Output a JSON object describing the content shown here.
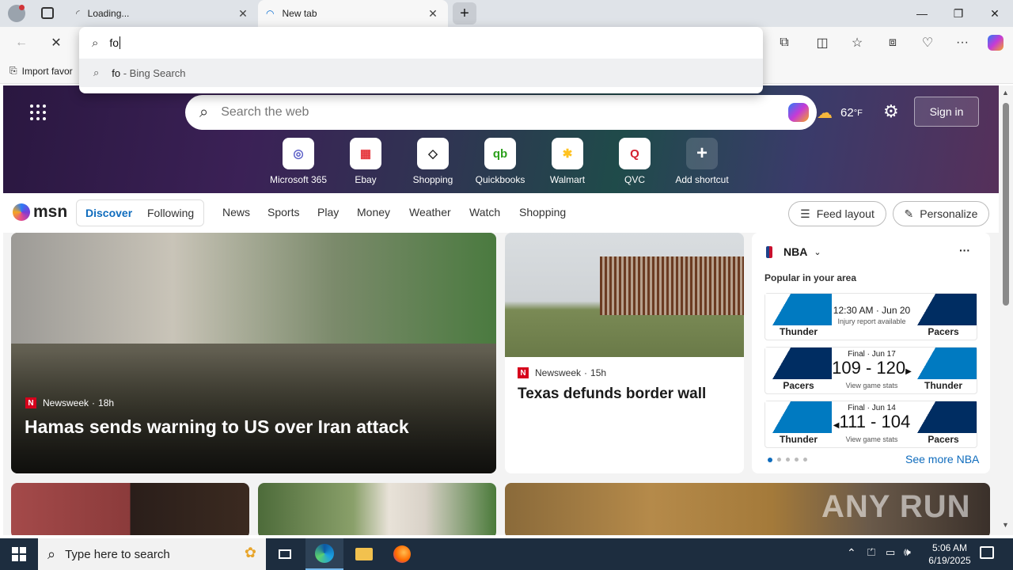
{
  "browser": {
    "tabs": [
      {
        "title": "Loading...",
        "close": "✕"
      },
      {
        "title": "New tab",
        "close": "✕"
      }
    ],
    "new_tab_symbol": "+",
    "window_controls": {
      "minimize": "—",
      "restore": "❐",
      "close": "✕"
    },
    "address_value": "fo",
    "suggestion": {
      "query": "fo",
      "suffix": " - Bing Search"
    },
    "favorites_import_label": "Import favor"
  },
  "msn": {
    "search_placeholder": "Search the web",
    "weather_temp": "62",
    "weather_unit": "°F",
    "sign_in": "Sign in",
    "shortcuts": [
      {
        "label": "Microsoft 365",
        "icon": "microsoft-365-icon",
        "glyph": "◎",
        "color": "#5b5fc7"
      },
      {
        "label": "Ebay",
        "icon": "ebay-icon",
        "glyph": "▦",
        "color": "#e53238"
      },
      {
        "label": "Shopping",
        "icon": "shopping-tag-icon",
        "glyph": "◇",
        "color": "#222222"
      },
      {
        "label": "Quickbooks",
        "icon": "quickbooks-icon",
        "glyph": "qb",
        "color": "#2ca01c"
      },
      {
        "label": "Walmart",
        "icon": "walmart-icon",
        "glyph": "✱",
        "color": "#ffc220"
      },
      {
        "label": "QVC",
        "icon": "qvc-icon",
        "glyph": "Q",
        "color": "#d4212f"
      },
      {
        "label": "Add shortcut",
        "icon": "add-icon",
        "glyph": "+",
        "color": "#ffffff"
      }
    ],
    "logo_text": "msn",
    "feed_tabs": {
      "active": "Discover",
      "other": "Following"
    },
    "nav_links": [
      "News",
      "Sports",
      "Play",
      "Money",
      "Weather",
      "Watch",
      "Shopping"
    ],
    "feed_layout": "Feed layout",
    "personalize": "Personalize"
  },
  "cards": {
    "main": {
      "source": "Newsweek",
      "age": "18h",
      "headline": "Hamas sends warning to US over Iran attack"
    },
    "border": {
      "source": "Newsweek",
      "age": "15h",
      "headline": "Texas defunds border wall"
    }
  },
  "nba": {
    "title": "NBA",
    "subtitle": "Popular in your area",
    "games": [
      {
        "left": "Thunder",
        "right": "Pacers",
        "line1": "12:30 AM · Jun 20",
        "line2": "Injury report available",
        "score": "",
        "colors": [
          "#007ac1",
          "#002d62"
        ]
      },
      {
        "left": "Pacers",
        "right": "Thunder",
        "line1": "Final · Jun 17",
        "score": "109 - 120",
        "winner": "right",
        "line2": "View game stats",
        "colors": [
          "#002d62",
          "#007ac1"
        ]
      },
      {
        "left": "Thunder",
        "right": "Pacers",
        "line1": "Final · Jun 14",
        "score": "111 - 104",
        "winner": "left",
        "line2": "View game stats",
        "colors": [
          "#007ac1",
          "#002d62"
        ]
      }
    ],
    "see_more": "See more NBA"
  },
  "watermark": "ANY RUN",
  "taskbar": {
    "search_placeholder": "Type here to search",
    "time": "5:06 AM",
    "date": "6/19/2025"
  }
}
